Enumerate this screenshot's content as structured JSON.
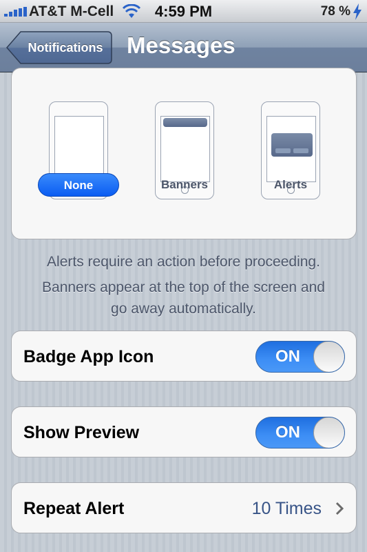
{
  "status_bar": {
    "carrier": "AT&T M-Cell",
    "time": "4:59 PM",
    "battery": "78 %"
  },
  "nav": {
    "back_label": "Notifications",
    "title": "Messages"
  },
  "alert_styles": {
    "options": [
      {
        "label": "None",
        "selected": true
      },
      {
        "label": "Banners",
        "selected": false
      },
      {
        "label": "Alerts",
        "selected": false
      }
    ]
  },
  "description": {
    "line1": "Alerts require an action before proceeding.",
    "line2": "Banners appear at the top of the screen and",
    "line3": "go away automatically."
  },
  "settings": {
    "badge_app_icon": {
      "label": "Badge App Icon",
      "toggle": "ON"
    },
    "show_preview": {
      "label": "Show Preview",
      "toggle": "ON"
    },
    "repeat_alert": {
      "label": "Repeat Alert",
      "value": "10 Times"
    }
  },
  "colors": {
    "accent": "#0a5cf2",
    "toggle_on": "#3d8ef5",
    "value_text": "#385487"
  }
}
